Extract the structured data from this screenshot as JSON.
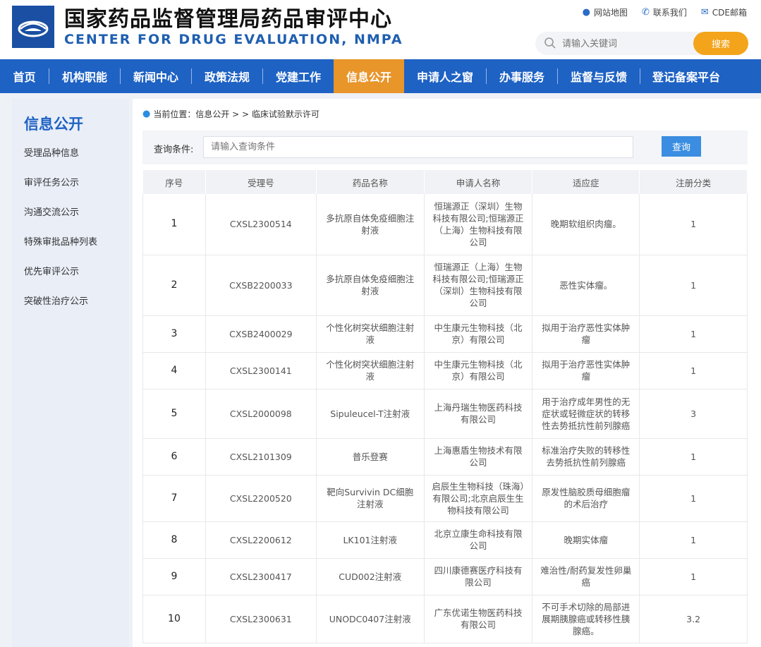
{
  "header": {
    "title_cn": "国家药品监督管理局药品审评中心",
    "title_en": "CENTER FOR DRUG EVALUATION, NMPA",
    "links": [
      {
        "label": "网站地图",
        "icon": "map-pin-icon"
      },
      {
        "label": "联系我们",
        "icon": "phone-icon"
      },
      {
        "label": "CDE邮箱",
        "icon": "mail-icon"
      }
    ],
    "search_placeholder": "请输入关键词",
    "search_button": "搜索"
  },
  "nav": {
    "items": [
      "首页",
      "机构职能",
      "新闻中心",
      "政策法规",
      "党建工作",
      "信息公开",
      "申请人之窗",
      "办事服务",
      "监督与反馈",
      "登记备案平台"
    ],
    "active_index": 5
  },
  "sidebar": {
    "title": "信息公开",
    "items": [
      "受理品种信息",
      "审评任务公示",
      "沟通交流公示",
      "特殊审批品种列表",
      "优先审评公示",
      "突破性治疗公示"
    ]
  },
  "breadcrumb": {
    "text": "当前位置：信息公开  >  >  临床试验默示许可"
  },
  "query": {
    "label": "查询条件:",
    "placeholder": "请输入查询条件",
    "button": "查询"
  },
  "table": {
    "headers": [
      "序号",
      "受理号",
      "药品名称",
      "申请人名称",
      "适应症",
      "注册分类"
    ],
    "rows": [
      [
        "1",
        "CXSL2300514",
        "多抗原自体免疫细胞注射液",
        "恒瑞源正（深圳）生物科技有限公司;恒瑞源正（上海）生物科技有限公司",
        "晚期软组织肉瘤。",
        "1"
      ],
      [
        "2",
        "CXSB2200033",
        "多抗原自体免疫细胞注射液",
        "恒瑞源正（上海）生物科技有限公司;恒瑞源正（深圳）生物科技有限公司",
        "恶性实体瘤。",
        "1"
      ],
      [
        "3",
        "CXSB2400029",
        "个性化树突状细胞注射液",
        "中生康元生物科技（北京）有限公司",
        "拟用于治疗恶性实体肿瘤",
        "1"
      ],
      [
        "4",
        "CXSL2300141",
        "个性化树突状细胞注射液",
        "中生康元生物科技（北京）有限公司",
        "拟用于治疗恶性实体肿瘤",
        "1"
      ],
      [
        "5",
        "CXSL2000098",
        "Sipuleucel-T注射液",
        "上海丹瑞生物医药科技有限公司",
        "用于治疗成年男性的无症状或轻微症状的转移性去势抵抗性前列腺癌",
        "3"
      ],
      [
        "6",
        "CXSL2101309",
        "普乐登赛",
        "上海惠盾生物技术有限公司",
        "标准治疗失败的转移性去势抵抗性前列腺癌",
        "1"
      ],
      [
        "7",
        "CXSL2200520",
        "靶向Survivin DC细胞注射液",
        "启辰生生物科技（珠海）有限公司;北京启辰生生物科技有限公司",
        "原发性脑胶质母细胞瘤的术后治疗",
        "1"
      ],
      [
        "8",
        "CXSL2200612",
        "LK101注射液",
        "北京立康生命科技有限公司",
        "晚期实体瘤",
        "1"
      ],
      [
        "9",
        "CXSL2300417",
        "CUD002注射液",
        "四川康德赛医疗科技有限公司",
        "难治性/耐药复发性卵巢癌",
        "1"
      ],
      [
        "10",
        "CXSL2300631",
        "UNODC0407注射液",
        "广东优诺生物医药科技有限公司",
        "不可手术切除的局部进展期胰腺癌或转移性胰腺癌。",
        "3.2"
      ]
    ]
  }
}
